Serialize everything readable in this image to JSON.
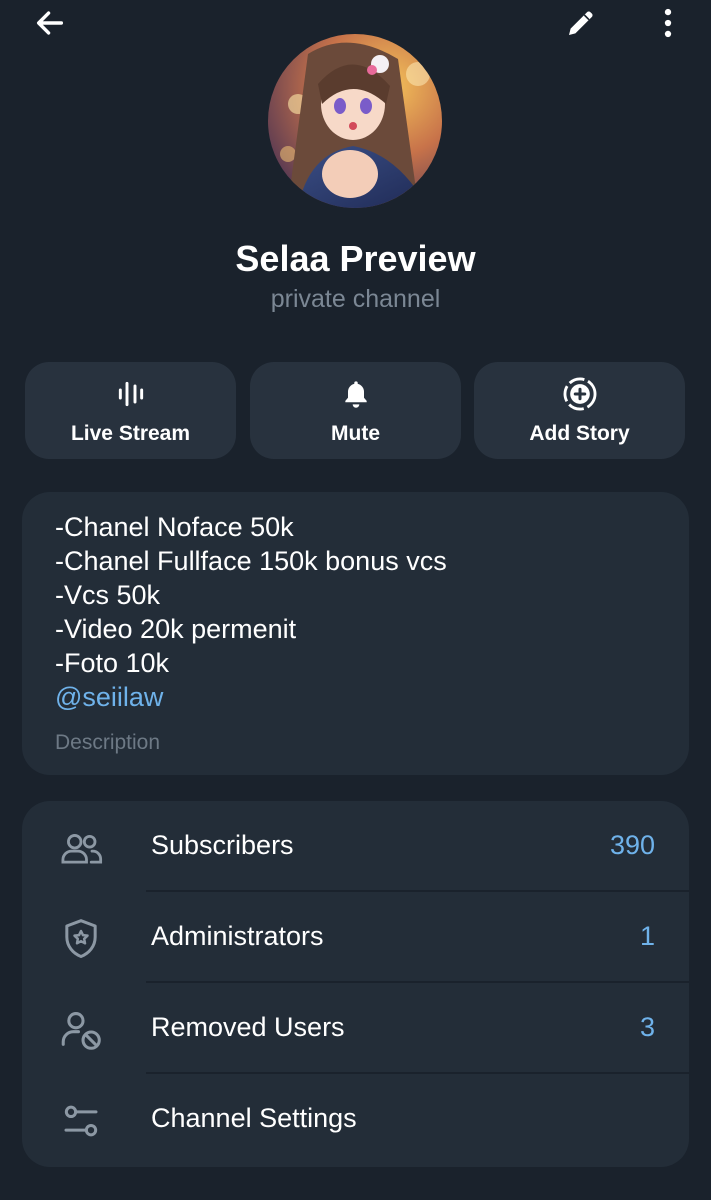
{
  "header": {
    "back_icon": "arrow-left-icon",
    "edit_icon": "pencil-icon",
    "more_icon": "more-vertical-icon"
  },
  "profile": {
    "title": "Selaa Preview",
    "subtitle": "private channel"
  },
  "actions": [
    {
      "label": "Live Stream",
      "icon": "live-stream-icon"
    },
    {
      "label": "Mute",
      "icon": "bell-icon"
    },
    {
      "label": "Add Story",
      "icon": "add-story-icon"
    }
  ],
  "description": {
    "lines": [
      "-Chanel Noface 50k",
      "-Chanel Fullface 150k bonus vcs",
      "-Vcs 50k",
      "-Video 20k permenit",
      "-Foto 10k"
    ],
    "link": "@seiilaw",
    "caption": "Description"
  },
  "info_rows": [
    {
      "label": "Subscribers",
      "value": "390",
      "icon": "users-icon"
    },
    {
      "label": "Administrators",
      "value": "1",
      "icon": "shield-star-icon"
    },
    {
      "label": "Removed Users",
      "value": "3",
      "icon": "user-blocked-icon"
    },
    {
      "label": "Channel Settings",
      "value": "",
      "icon": "sliders-icon"
    }
  ],
  "colors": {
    "background": "#1a222c",
    "card": "#232d38",
    "button": "#28323e",
    "accent": "#6fb2ea",
    "muted_text": "#7b8794"
  }
}
